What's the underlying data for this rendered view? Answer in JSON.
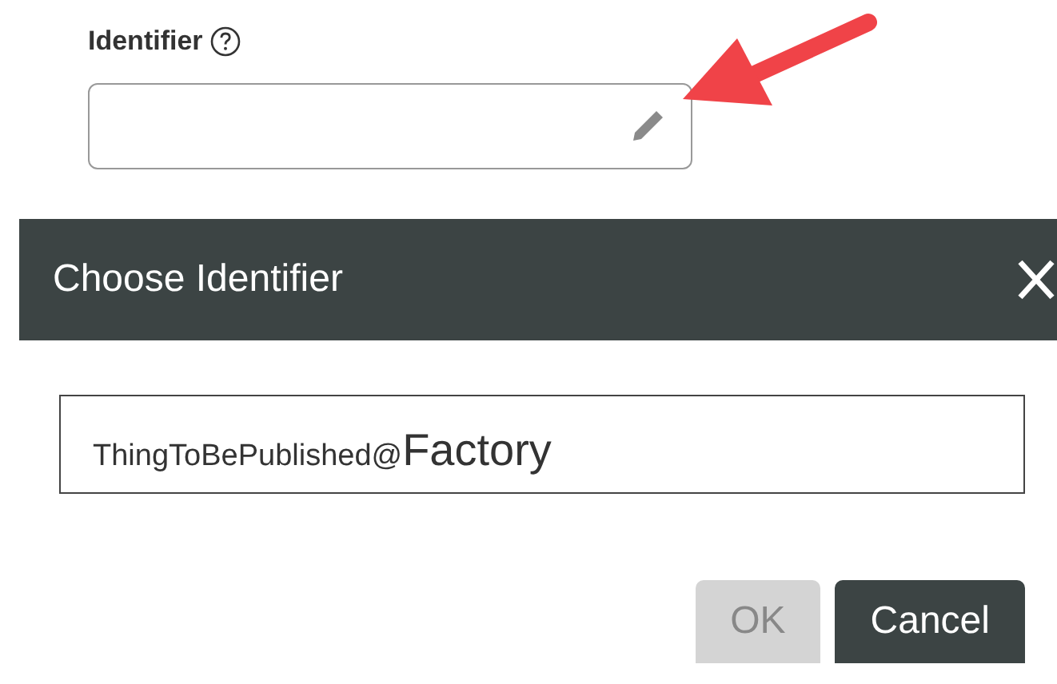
{
  "field": {
    "label": "Identifier"
  },
  "dialog": {
    "title": "Choose Identifier",
    "value_parts": [
      "ThingToBePublished@",
      "Factory"
    ],
    "buttons": [
      {
        "label": "OK",
        "disabled": true,
        "kind": "plain"
      },
      {
        "label": "Cancel",
        "disabled": false,
        "kind": "dark"
      }
    ]
  }
}
